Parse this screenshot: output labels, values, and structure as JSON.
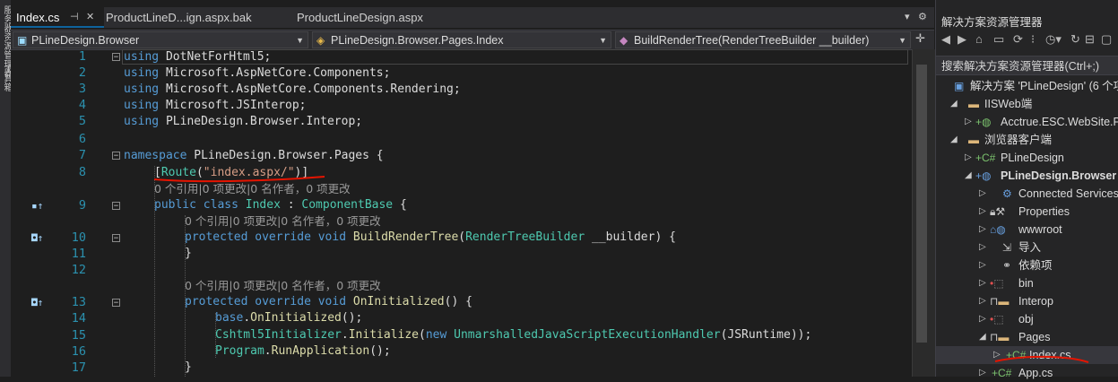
{
  "left_strip": {
    "labels": [
      "服务器资源管理器",
      "工具箱"
    ]
  },
  "tabs": [
    {
      "label": "Index.cs",
      "active": true,
      "pin": "⊣",
      "close": "✕"
    },
    {
      "label": "ProductLineD...ign.aspx.bak",
      "active": false
    },
    {
      "label": "ProductLineDesign.aspx",
      "active": false
    }
  ],
  "tab_actions": {
    "dropdown": "▾",
    "settings": "⚙"
  },
  "navbar": {
    "project": "PLineDesign.Browser",
    "class": "PLineDesign.Browser.Pages.Index",
    "member": "BuildRenderTree(RenderTreeBuilder __builder)",
    "split": "✛"
  },
  "code": {
    "line_numbers": [
      "1",
      "2",
      "3",
      "4",
      "5",
      "6",
      "7",
      "8",
      "",
      "9",
      "",
      "10",
      "11",
      "12",
      "",
      "13",
      "14",
      "15",
      "16",
      "17"
    ],
    "l1": [
      "using",
      "DotNetForHtml5;"
    ],
    "l2": [
      "using",
      "Microsoft.AspNetCore.Components;"
    ],
    "l3": [
      "using",
      "Microsoft.AspNetCore.Components.Rendering;"
    ],
    "l4": [
      "using",
      "Microsoft.JSInterop;"
    ],
    "l5": [
      "using",
      "PLineDesign.Browser.Interop;"
    ],
    "l7": [
      "namespace",
      "PLineDesign.Browser.Pages",
      "{"
    ],
    "l8": [
      "[",
      "Route",
      "(",
      "\"index.aspx/\"",
      ")]"
    ],
    "lens1": "0 个引用|0 项更改|0 名作者，0 项更改",
    "l9": [
      "public",
      "class",
      "Index",
      ":",
      "ComponentBase",
      "{"
    ],
    "lens2": "0 个引用|0 项更改|0 名作者，0 项更改",
    "l10": [
      "protected",
      "override",
      "void",
      "BuildRenderTree",
      "(",
      "RenderTreeBuilder",
      "__builder",
      ")",
      "{"
    ],
    "l11": "}",
    "lens3": "0 个引用|0 项更改|0 名作者，0 项更改",
    "l13": [
      "protected",
      "override",
      "void",
      "OnInitialized",
      "()",
      "{"
    ],
    "l14": [
      "base",
      ".",
      "OnInitialized",
      "();"
    ],
    "l15": [
      "Cshtml5Initializer",
      ".",
      "Initialize",
      "(",
      "new",
      "UnmarshalledJavaScriptExecutionHandler",
      "(",
      "JSRuntime",
      "));"
    ],
    "l16": [
      "Program",
      ".",
      "RunApplication",
      "();"
    ],
    "l17": "}"
  },
  "solution_explorer": {
    "title": "解决方案资源管理器",
    "search_placeholder": "搜索解决方案资源管理器(Ctrl+;)",
    "items": [
      {
        "label": "解决方案 'PLineDesign' (6 个项",
        "icon": "solution-icon"
      },
      {
        "label": "IISWeb端",
        "icon": "folder-icon"
      },
      {
        "label": "Acctrue.ESC.WebSite.P",
        "icon": "web-project-icon"
      },
      {
        "label": "浏览器客户端",
        "icon": "folder-icon"
      },
      {
        "label": "PLineDesign",
        "icon": "csharp-project-icon"
      },
      {
        "label": "PLineDesign.Browser",
        "icon": "web-project-icon"
      },
      {
        "label": "Connected Services",
        "icon": "connected-services-icon"
      },
      {
        "label": "Properties",
        "icon": "wrench-icon"
      },
      {
        "label": "wwwroot",
        "icon": "globe-icon"
      },
      {
        "label": "导入",
        "icon": "import-icon"
      },
      {
        "label": "依赖项",
        "icon": "dependencies-icon"
      },
      {
        "label": "bin",
        "icon": "folder-icon"
      },
      {
        "label": "Interop",
        "icon": "folder-icon"
      },
      {
        "label": "obj",
        "icon": "folder-icon"
      },
      {
        "label": "Pages",
        "icon": "folder-open-icon"
      },
      {
        "label": "Index.cs",
        "icon": "csharp-file-icon"
      },
      {
        "label": "App.cs",
        "icon": "csharp-file-icon"
      }
    ]
  },
  "colors": {
    "keyword": "#569cd6",
    "type": "#4ec9b0",
    "method": "#dcdcaa",
    "string": "#d69d85",
    "annotation": "#e51400"
  }
}
